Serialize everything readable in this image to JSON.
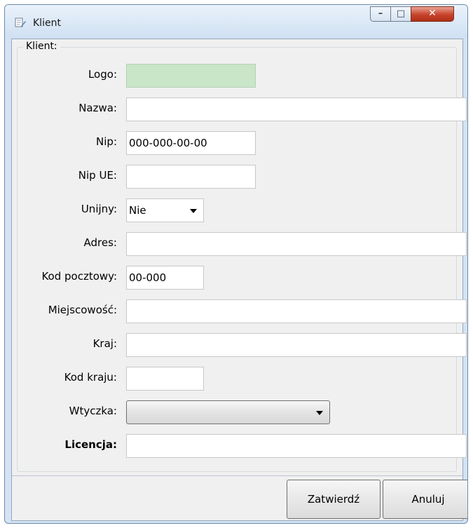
{
  "window": {
    "title": "Klient",
    "min_glyph": "–",
    "max_glyph": "□",
    "close_glyph": "✕"
  },
  "group": {
    "label": "Klient:"
  },
  "fields": {
    "logo": {
      "label": "Logo:",
      "value": ""
    },
    "nazwa": {
      "label": "Nazwa:",
      "value": ""
    },
    "nip": {
      "label": "Nip:",
      "value": "000-000-00-00"
    },
    "nip_ue": {
      "label": "Nip UE:",
      "value": ""
    },
    "unijny": {
      "label": "Unijny:",
      "value": "Nie"
    },
    "adres": {
      "label": "Adres:",
      "value": ""
    },
    "kod_pocztowy": {
      "label": "Kod pocztowy:",
      "value": "00-000"
    },
    "miejscowosc": {
      "label": "Miejscowość:",
      "value": ""
    },
    "kraj": {
      "label": "Kraj:",
      "value": ""
    },
    "kod_kraju": {
      "label": "Kod kraju:",
      "value": ""
    },
    "wtyczka": {
      "label": "Wtyczka:",
      "value": ""
    },
    "licencja": {
      "label": "Licencja:",
      "value": ""
    }
  },
  "buttons": {
    "confirm": "Zatwierdź",
    "cancel": "Anuluj"
  },
  "colors": {
    "logo_fill": "#c9e6c9",
    "close_button": "#c7432b"
  }
}
